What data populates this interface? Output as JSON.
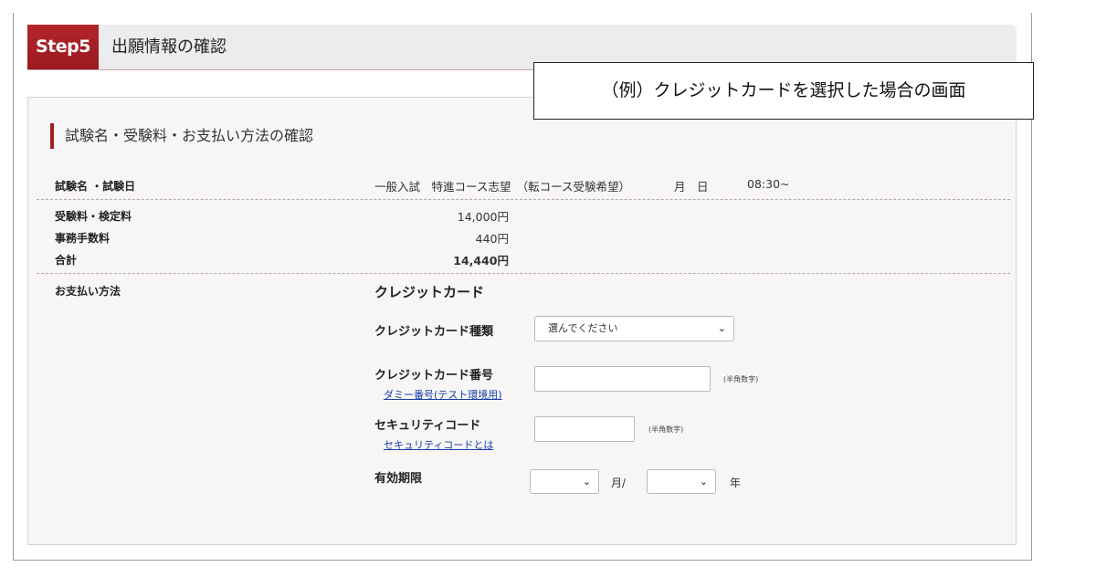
{
  "header": {
    "step_badge": "Step5",
    "title": "出願情報の確認"
  },
  "note": "（例）クレジットカードを選択した場合の画面",
  "section": {
    "title": "試験名・受験料・お支払い方法の確認"
  },
  "exam": {
    "label": "試験名 ・試験日",
    "name": "一般入試　特進コース志望　（転コース受験希望）",
    "date": "月　日",
    "time": "08:30~"
  },
  "fees": {
    "items": [
      {
        "label": "受験料・検定料",
        "amount": "14,000円"
      },
      {
        "label": "事務手数料",
        "amount": "440円"
      },
      {
        "label": "合計",
        "amount": "14,440円"
      }
    ]
  },
  "payment": {
    "label": "お支払い方法",
    "method": "クレジットカード",
    "card_type": {
      "label": "クレジットカード種類",
      "selected": "選んでください"
    },
    "card_number": {
      "label": "クレジットカード番号",
      "link": "ダミー番号(テスト環境用)",
      "value": "",
      "hint": "(半角数字)"
    },
    "security_code": {
      "label": "セキュリティコード",
      "link": "セキュリティコードとは",
      "value": "",
      "hint": "(半角数字)"
    },
    "expiry": {
      "label": "有効期限",
      "month_selected": "",
      "month_unit": "月/",
      "year_selected": "",
      "year_unit": "年"
    }
  },
  "colors": {
    "brand": "#a11e24",
    "link": "#1a3ea8",
    "panel_bg": "#f7f6f4"
  }
}
